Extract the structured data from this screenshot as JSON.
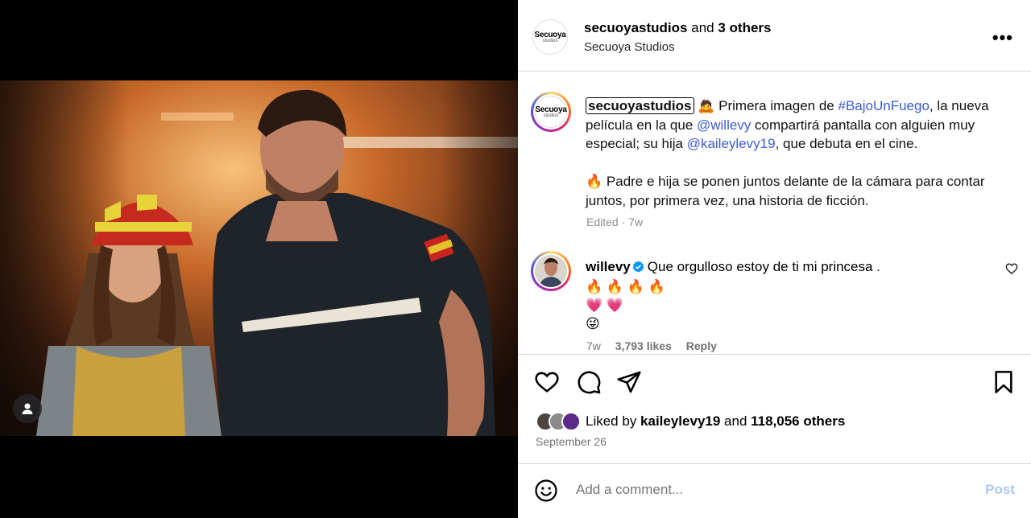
{
  "header": {
    "username": "secuoyastudios",
    "and_text": "and",
    "others": "3 others",
    "subtitle": "Secuoya Studios",
    "more": "•••"
  },
  "logo": {
    "main": "Secuoya",
    "sub": "studios"
  },
  "caption": {
    "username": "secuoyastudios",
    "p1_a": " Primera imagen de ",
    "hashtag": "#BajoUnFuego",
    "p1_b": ", la nueva película en la que ",
    "mention1": "@willevy",
    "p1_c": " compartirá pantalla con alguien muy especial; su hija ",
    "mention2": "@kaileylevy19",
    "p1_d": ", que debuta en el cine.",
    "p2": " Padre e hija se ponen juntos delante de la cámara para contar juntos, por primera vez, una historia de ficción.",
    "meta": "Edited · 7w"
  },
  "comment": {
    "username": "willevy",
    "text": "Que orgulloso estoy de ti mi princesa .",
    "emoji_line1": "🔥 🔥 🔥 🔥",
    "emoji_line2": "💗 💗",
    "emoji_line3": "😜",
    "time": "7w",
    "likes": "3,793 likes",
    "reply": "Reply"
  },
  "likes": {
    "prefix": "Liked by ",
    "user": "kaileylevy19",
    "mid": " and ",
    "count": "118,056 others"
  },
  "date": "September 26",
  "comment_bar": {
    "placeholder": "Add a comment...",
    "post": "Post"
  },
  "colors": {
    "link": "#3b5bdb",
    "post_disabled": "#a8c8fa",
    "divider": "#dbdbdb"
  }
}
